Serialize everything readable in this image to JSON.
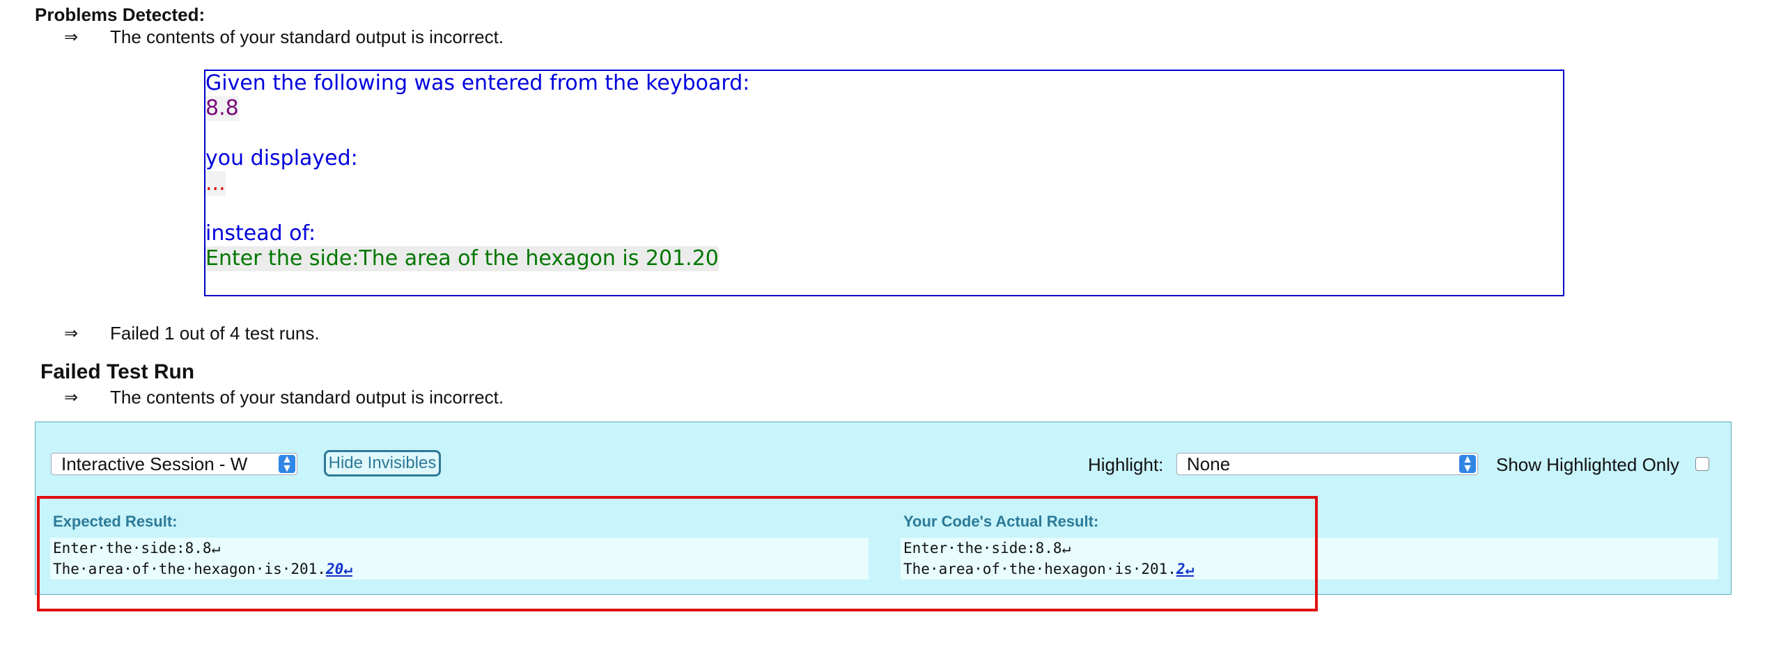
{
  "problems": {
    "heading": "Problems Detected:",
    "arrow": "⇒",
    "items": [
      "The contents of your standard output is incorrect.",
      "Failed 1 out of 4 test runs."
    ]
  },
  "message": {
    "given_label": "Given the following was entered from the keyboard:",
    "input_value": "8.8",
    "displayed_label": "you displayed:",
    "displayed_value": "...",
    "instead_label": "instead of:",
    "expected_value": "Enter the side:The area of the hexagon is 201.20"
  },
  "failed_run": {
    "heading": "Failed Test Run",
    "message": "The contents of your standard output is incorrect."
  },
  "panel": {
    "session_select": "Interactive Session - W",
    "hide_invisibles_label": "Hide Invisibles",
    "highlight_label": "Highlight:",
    "highlight_value": "None",
    "show_highlighted_only_label": "Show Highlighted Only",
    "expected": {
      "label": "Expected Result:",
      "line1": "Enter·the·side:8.8↵",
      "line2_prefix": "The·area·of·the·hexagon·is·201.",
      "line2_diff": "20↵"
    },
    "actual": {
      "label": "Your Code's Actual Result:",
      "line1": "Enter·the·side:8.8↵",
      "line2_prefix": "The·area·of·the·hexagon·is·201.",
      "line2_diff": "2↵"
    }
  },
  "colors": {
    "message_border": "#0000cc",
    "panel_bg": "#c8f4fb",
    "annotation_frame": "#e01010"
  }
}
